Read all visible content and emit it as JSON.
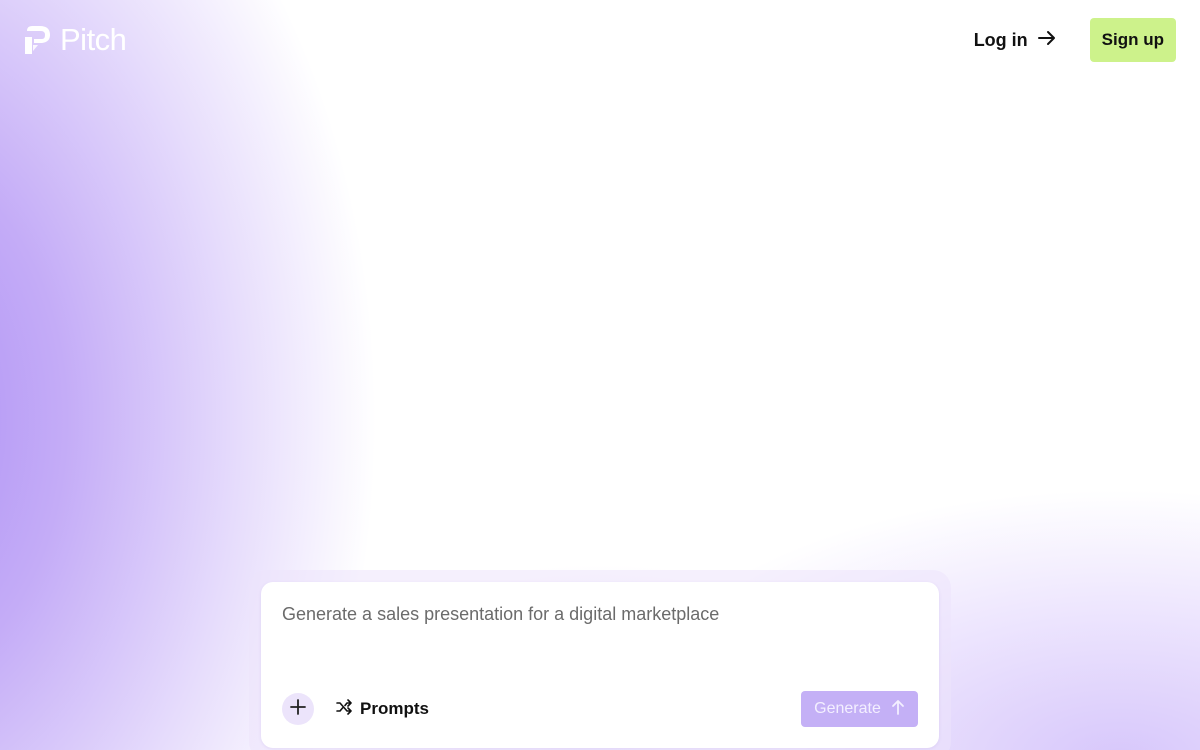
{
  "header": {
    "brand": "Pitch",
    "logo_icon": "pitch-logo-icon",
    "login_label": "Log in",
    "login_icon": "arrow-right-icon",
    "signup_label": "Sign up"
  },
  "composer": {
    "placeholder": "Generate a sales presentation for a digital marketplace",
    "add_icon": "plus-icon",
    "prompts_icon": "shuffle-icon",
    "prompts_label": "Prompts",
    "generate_label": "Generate",
    "generate_icon": "arrow-up-icon"
  },
  "colors": {
    "accent_green": "#cdf28b",
    "accent_purple": "#c4b0f6",
    "background_purple": "#a98bf5"
  }
}
